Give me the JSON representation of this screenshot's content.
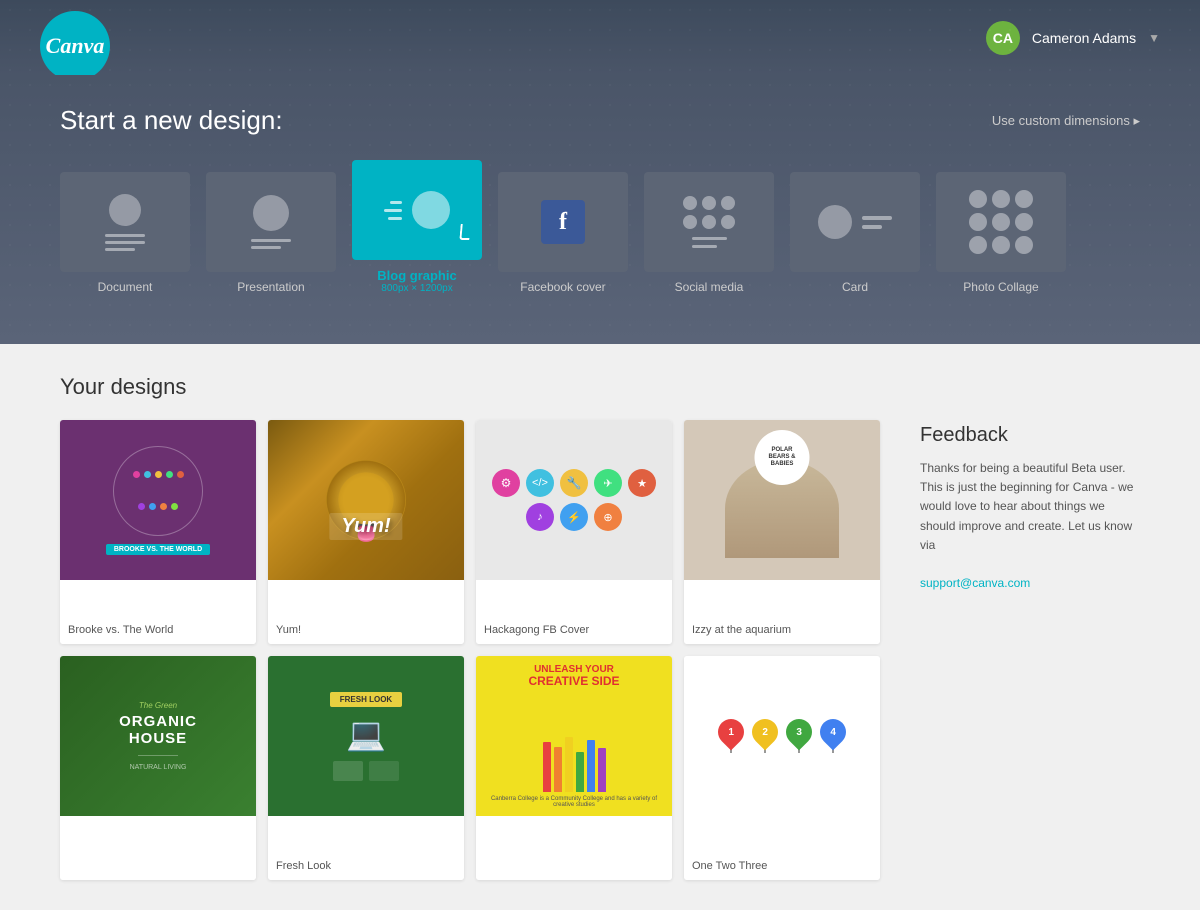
{
  "header": {
    "logo": "Canva",
    "user": {
      "name": "Cameron Adams",
      "initials": "CA",
      "dropdown_label": "▼"
    }
  },
  "new_design": {
    "title": "Start a new design:",
    "custom_dimensions": "Use custom dimensions ▸",
    "design_types": [
      {
        "id": "document",
        "label": "Document",
        "sublabel": "",
        "active": false
      },
      {
        "id": "presentation",
        "label": "Presentation",
        "sublabel": "",
        "active": false
      },
      {
        "id": "blog-graphic",
        "label": "Blog graphic",
        "sublabel": "800px × 1200px",
        "active": true
      },
      {
        "id": "facebook-cover",
        "label": "Facebook cover",
        "sublabel": "",
        "active": false
      },
      {
        "id": "social-media",
        "label": "Social media",
        "sublabel": "",
        "active": false
      },
      {
        "id": "card",
        "label": "Card",
        "sublabel": "",
        "active": false
      },
      {
        "id": "photo-collage",
        "label": "Photo Collage",
        "sublabel": "",
        "active": false
      }
    ]
  },
  "your_designs": {
    "title": "Your designs",
    "designs": [
      {
        "id": "brooke",
        "label": "Brooke vs. The World",
        "type": "brooke"
      },
      {
        "id": "yum",
        "label": "Yum!",
        "type": "lion"
      },
      {
        "id": "hackagong",
        "label": "Hackagong FB Cover",
        "type": "hackagong"
      },
      {
        "id": "izzy",
        "label": "Izzy at the aquarium",
        "type": "izzy"
      },
      {
        "id": "organic",
        "label": "",
        "type": "organic"
      },
      {
        "id": "fresh",
        "label": "Fresh Look",
        "type": "fresh"
      },
      {
        "id": "unleash",
        "label": "",
        "type": "pencils"
      },
      {
        "id": "onetwo",
        "label": "One Two Three",
        "type": "onetwo"
      }
    ]
  },
  "feedback": {
    "title": "Feedback",
    "text": "Thanks for being a beautiful Beta user. This is just the beginning for Canva - we would love to hear about things we should improve and create. Let us know via",
    "link_text": "support@canva.com",
    "link_href": "mailto:support@canva.com"
  }
}
